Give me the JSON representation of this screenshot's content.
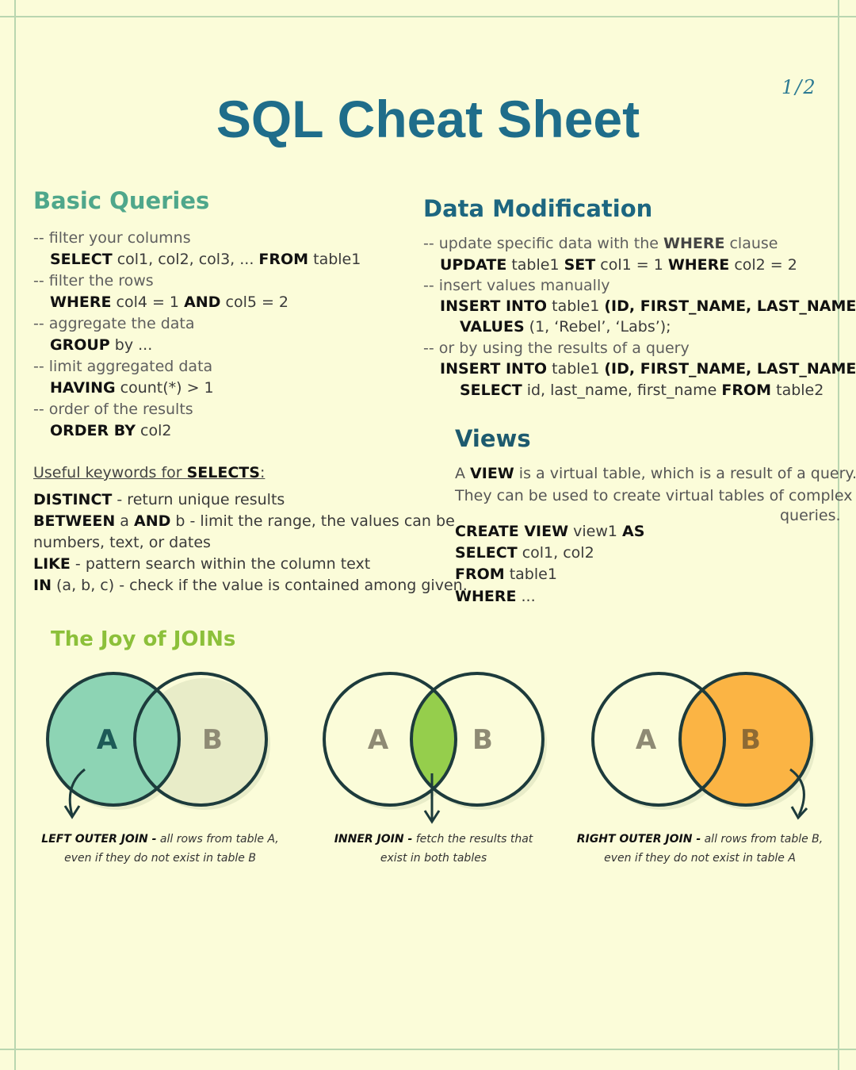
{
  "page_number": "1/2",
  "title": "SQL Cheat Sheet",
  "basic": {
    "heading": "Basic Queries",
    "c1": "-- filter your columns",
    "l1": {
      "k1": "SELECT",
      "t1": " col1, col2, col3, ... ",
      "k2": "FROM",
      "t2": " table1"
    },
    "c2": "-- filter the rows",
    "l2": {
      "k1": "WHERE",
      "t1": " col4 = 1 ",
      "k2": "AND",
      "t2": " col5 = 2"
    },
    "c3": "-- aggregate the data",
    "l3": {
      "k1": "GROUP",
      "t1": " by ..."
    },
    "c4": "-- limit aggregated data",
    "l4": {
      "k1": "HAVING",
      "t1": " count(*) > 1"
    },
    "c5": "-- order of the results",
    "l5": {
      "k1": "ORDER BY",
      "t1": " col2"
    }
  },
  "keywords": {
    "intro": "Useful keywords for ",
    "intro_kw": "SELECTS",
    "intro_end": ":",
    "distinct": {
      "kw": "DISTINCT",
      "text": " - return unique results"
    },
    "between": {
      "kw1": "BETWEEN",
      "t1": " a ",
      "kw2": "AND",
      "t2": " b - limit the range, the values can be",
      "t3": "numbers, text, or dates"
    },
    "like": {
      "kw": "LIKE",
      "text": " - pattern search within the column text"
    },
    "in": {
      "kw": "IN",
      "text": " (a, b, c) - check if the value is contained among given."
    }
  },
  "modification": {
    "heading": "Data Modification",
    "c1": {
      "t1": "-- update specific data with the ",
      "kw": "WHERE",
      "t2": " clause"
    },
    "l1": {
      "k1": "UPDATE",
      "t1": " table1 ",
      "k2": "SET",
      "t2": " col1 = 1 ",
      "k3": "WHERE",
      "t3": " col2 = 2"
    },
    "c2": "-- insert values manually",
    "l2": {
      "k1": "INSERT INTO",
      "t1": " table1 ",
      "k2": "(ID, FIRST_NAME, LAST_NAME)"
    },
    "l3": {
      "k1": "VALUES",
      "t1": " (1, ‘Rebel’, ‘Labs’);"
    },
    "c3": "-- or by using the results of a query",
    "l4": {
      "k1": "INSERT INTO",
      "t1": " table1 ",
      "k2": "(ID, FIRST_NAME, LAST_NAME)"
    },
    "l5": {
      "k1": "SELECT",
      "t1": " id, last_name, first_name ",
      "k2": "FROM",
      "t2": " table2"
    }
  },
  "views": {
    "heading": "Views",
    "d1": {
      "t1": "A ",
      "kw": "VIEW",
      "t2": " is a virtual table, which is a result  of a query."
    },
    "d2": "They can be used to create virtual tables of complex",
    "d3": "queries.",
    "l1": {
      "k1": "CREATE VIEW",
      "t1": " view1 ",
      "k2": "AS"
    },
    "l2": {
      "k1": "SELECT",
      "t1": " col1, col2"
    },
    "l3": {
      "k1": "FROM",
      "t1": " table1"
    },
    "l4": {
      "k1": "WHERE",
      "t1": " ..."
    }
  },
  "joins": {
    "heading": "The Joy of JOINs",
    "label_a": "A",
    "label_b": "B",
    "left": {
      "kw": "LEFT OUTER JOIN -",
      "t1": " all rows from table A,",
      "t2": "even if they do not exist in table B"
    },
    "inner": {
      "kw": "INNER JOIN -",
      "t1": " fetch the results that",
      "t2": "exist in both tables"
    },
    "right": {
      "kw": "RIGHT OUTER JOIN -",
      "t1": " all rows from table B,",
      "t2": "even if they do not exist in table A"
    },
    "colors": {
      "left_fill": "#8dd4b4",
      "inner_fill": "#95ce4c",
      "right_fill": "#fbb444",
      "stroke": "#1d3b3c",
      "label_dark": "#1d5a57",
      "label_muted": "#8e8a74"
    }
  }
}
